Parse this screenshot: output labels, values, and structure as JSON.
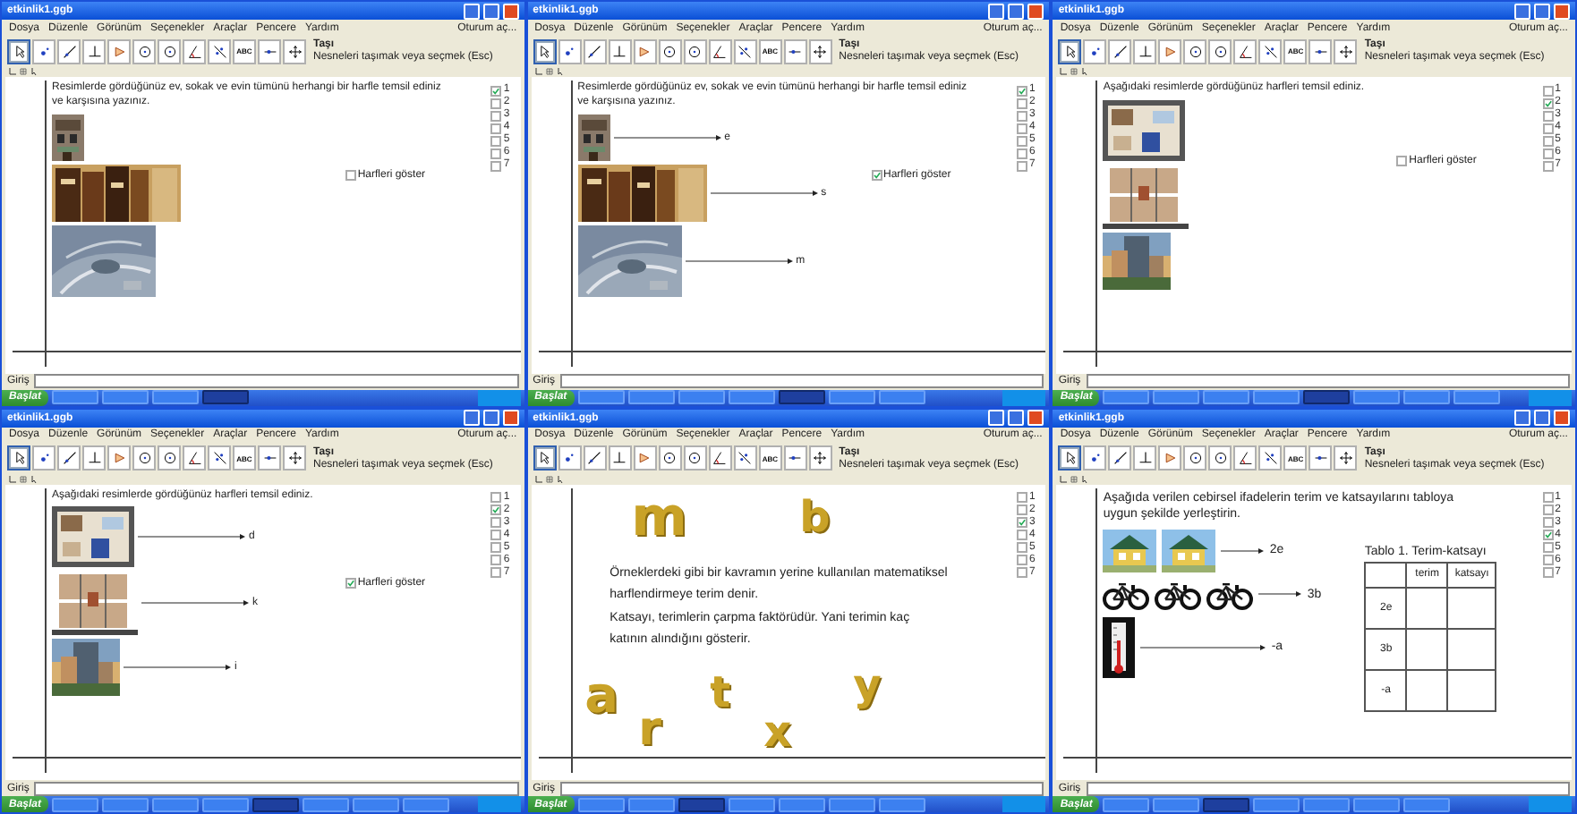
{
  "panels": [
    {
      "kind": "photos",
      "title": "etkinlik1.ggb",
      "menu": [
        "Dosya",
        "Düzenle",
        "Görünüm",
        "Seçenekler",
        "Araçlar",
        "Pencere",
        "Yardım"
      ],
      "login": "Oturum aç...",
      "tool_name": "Taşı",
      "tool_hint": "Nesneleri taşımak veya seçmek (Esc)",
      "tools": [
        {
          "kind": "pointer",
          "selected": true
        },
        {
          "kind": "point",
          "selected": false
        },
        {
          "kind": "line",
          "selected": false
        },
        {
          "kind": "perpendicular",
          "selected": false
        },
        {
          "kind": "polygon",
          "selected": false
        },
        {
          "kind": "circle",
          "selected": false
        },
        {
          "kind": "circle",
          "selected": false
        },
        {
          "kind": "angle",
          "selected": false
        },
        {
          "kind": "reflect",
          "selected": false
        },
        {
          "kind": "text",
          "label": "ABC",
          "selected": false
        },
        {
          "kind": "slider",
          "selected": false
        },
        {
          "kind": "move",
          "selected": false
        }
      ],
      "steps": [
        {
          "label": "1",
          "checked": true
        },
        {
          "label": "2",
          "checked": false
        },
        {
          "label": "3",
          "checked": false
        },
        {
          "label": "4",
          "checked": false
        },
        {
          "label": "5",
          "checked": false
        },
        {
          "label": "6",
          "checked": false
        },
        {
          "label": "7",
          "checked": false
        }
      ],
      "intro": "Resimlerde gördüğünüz ev, sokak ve evin tümünü herhangi bir harfle temsil ediniz ve karşısına yazınız.",
      "show": {
        "label": "Harfleri göster",
        "checked": false
      },
      "rows": [
        {
          "pictures": [
            {
              "kind": "facade"
            }
          ]
        },
        {
          "pictures": [
            {
              "kind": "street"
            }
          ]
        },
        {
          "pictures": [
            {
              "kind": "aerial"
            }
          ]
        }
      ],
      "input_label": "Giriş",
      "start": "Başlat",
      "tasks": [
        {
          "selected": false
        },
        {
          "selected": false
        },
        {
          "selected": false
        },
        {
          "selected": true
        }
      ]
    },
    {
      "kind": "photos",
      "title": "etkinlik1.ggb",
      "menu": [
        "Dosya",
        "Düzenle",
        "Görünüm",
        "Seçenekler",
        "Araçlar",
        "Pencere",
        "Yardım"
      ],
      "login": "Oturum aç...",
      "tool_name": "Taşı",
      "tool_hint": "Nesneleri taşımak veya seçmek (Esc)",
      "tools": [
        {
          "kind": "pointer",
          "selected": true
        },
        {
          "kind": "point",
          "selected": false
        },
        {
          "kind": "line",
          "selected": false
        },
        {
          "kind": "perpendicular",
          "selected": false
        },
        {
          "kind": "polygon",
          "selected": false
        },
        {
          "kind": "circle",
          "selected": false
        },
        {
          "kind": "circle",
          "selected": false
        },
        {
          "kind": "angle",
          "selected": false
        },
        {
          "kind": "reflect",
          "selected": false
        },
        {
          "kind": "text",
          "label": "ABC",
          "selected": false
        },
        {
          "kind": "slider",
          "selected": false
        },
        {
          "kind": "move",
          "selected": false
        }
      ],
      "steps": [
        {
          "label": "1",
          "checked": true
        },
        {
          "label": "2",
          "checked": false
        },
        {
          "label": "3",
          "checked": false
        },
        {
          "label": "4",
          "checked": false
        },
        {
          "label": "5",
          "checked": false
        },
        {
          "label": "6",
          "checked": false
        },
        {
          "label": "7",
          "checked": false
        }
      ],
      "intro": "Resimlerde gördüğünüz ev, sokak ve evin tümünü herhangi bir harfle temsil ediniz ve karşısına yazınız.",
      "show": {
        "label": "Harfleri göster",
        "checked": true
      },
      "rows": [
        {
          "pictures": [
            {
              "kind": "facade"
            }
          ],
          "label": "e"
        },
        {
          "pictures": [
            {
              "kind": "street"
            }
          ],
          "label": "s"
        },
        {
          "pictures": [
            {
              "kind": "aerial"
            }
          ],
          "label": "m"
        }
      ],
      "input_label": "Giriş",
      "start": "Başlat",
      "tasks": [
        {
          "selected": false
        },
        {
          "selected": false
        },
        {
          "selected": false
        },
        {
          "selected": false
        },
        {
          "selected": true
        },
        {
          "selected": false
        },
        {
          "selected": false
        }
      ]
    },
    {
      "kind": "photos",
      "title": "etkinlik1.ggb",
      "menu": [
        "Dosya",
        "Düzenle",
        "Görünüm",
        "Seçenekler",
        "Araçlar",
        "Pencere",
        "Yardım"
      ],
      "login": "Oturum aç...",
      "tool_name": "Taşı",
      "tool_hint": "Nesneleri taşımak veya seçmek (Esc)",
      "tools": [
        {
          "kind": "pointer",
          "selected": true
        },
        {
          "kind": "point",
          "selected": false
        },
        {
          "kind": "line",
          "selected": false
        },
        {
          "kind": "perpendicular",
          "selected": false
        },
        {
          "kind": "polygon",
          "selected": false
        },
        {
          "kind": "circle",
          "selected": false
        },
        {
          "kind": "circle",
          "selected": false
        },
        {
          "kind": "angle",
          "selected": false
        },
        {
          "kind": "reflect",
          "selected": false
        },
        {
          "kind": "text",
          "label": "ABC",
          "selected": false
        },
        {
          "kind": "slider",
          "selected": false
        },
        {
          "kind": "move",
          "selected": false
        }
      ],
      "steps": [
        {
          "label": "1",
          "checked": false
        },
        {
          "label": "2",
          "checked": true
        },
        {
          "label": "3",
          "checked": false
        },
        {
          "label": "4",
          "checked": false
        },
        {
          "label": "5",
          "checked": false
        },
        {
          "label": "6",
          "checked": false
        },
        {
          "label": "7",
          "checked": false
        }
      ],
      "intro": "Aşağıdaki resimlerde gördüğünüz harfleri temsil ediniz.",
      "show": {
        "label": "Harfleri göster",
        "checked": false
      },
      "rows": [
        {
          "pictures": [
            {
              "kind": "room"
            }
          ]
        },
        {
          "pictures": [
            {
              "kind": "plan"
            }
          ]
        },
        {
          "pictures": [
            {
              "kind": "tower"
            }
          ]
        }
      ],
      "input_label": "Giriş",
      "start": "Başlat",
      "tasks": [
        {
          "selected": false
        },
        {
          "selected": false
        },
        {
          "selected": false
        },
        {
          "selected": false
        },
        {
          "selected": true
        },
        {
          "selected": false
        },
        {
          "selected": false
        },
        {
          "selected": false
        }
      ]
    },
    {
      "kind": "photos",
      "title": "etkinlik1.ggb",
      "menu": [
        "Dosya",
        "Düzenle",
        "Görünüm",
        "Seçenekler",
        "Araçlar",
        "Pencere",
        "Yardım"
      ],
      "login": "Oturum aç...",
      "tool_name": "Taşı",
      "tool_hint": "Nesneleri taşımak veya seçmek (Esc)",
      "tools": [
        {
          "kind": "pointer",
          "selected": true
        },
        {
          "kind": "point",
          "selected": false
        },
        {
          "kind": "line",
          "selected": false
        },
        {
          "kind": "perpendicular",
          "selected": false
        },
        {
          "kind": "polygon",
          "selected": false
        },
        {
          "kind": "circle",
          "selected": false
        },
        {
          "kind": "circle",
          "selected": false
        },
        {
          "kind": "angle",
          "selected": false
        },
        {
          "kind": "reflect",
          "selected": false
        },
        {
          "kind": "text",
          "label": "ABC",
          "selected": false
        },
        {
          "kind": "slider",
          "selected": false
        },
        {
          "kind": "move",
          "selected": false
        }
      ],
      "steps": [
        {
          "label": "1",
          "checked": false
        },
        {
          "label": "2",
          "checked": true
        },
        {
          "label": "3",
          "checked": false
        },
        {
          "label": "4",
          "checked": false
        },
        {
          "label": "5",
          "checked": false
        },
        {
          "label": "6",
          "checked": false
        },
        {
          "label": "7",
          "checked": false
        }
      ],
      "intro": "Aşağıdaki resimlerde gördüğünüz harfleri temsil ediniz.",
      "show": {
        "label": "Harfleri göster",
        "checked": true
      },
      "rows": [
        {
          "pictures": [
            {
              "kind": "room"
            }
          ],
          "label": "d"
        },
        {
          "pictures": [
            {
              "kind": "plan"
            }
          ],
          "label": "k"
        },
        {
          "pictures": [
            {
              "kind": "tower"
            }
          ],
          "label": "i"
        }
      ],
      "input_label": "Giriş",
      "start": "Başlat",
      "tasks": [
        {
          "selected": false
        },
        {
          "selected": false
        },
        {
          "selected": false
        },
        {
          "selected": false
        },
        {
          "selected": true
        },
        {
          "selected": false
        },
        {
          "selected": false
        },
        {
          "selected": false
        }
      ]
    },
    {
      "kind": "letters",
      "title": "etkinlik1.ggb",
      "menu": [
        "Dosya",
        "Düzenle",
        "Görünüm",
        "Seçenekler",
        "Araçlar",
        "Pencere",
        "Yardım"
      ],
      "login": "Oturum aç...",
      "tool_name": "Taşı",
      "tool_hint": "Nesneleri taşımak veya seçmek (Esc)",
      "tools": [
        {
          "kind": "pointer",
          "selected": true
        },
        {
          "kind": "point",
          "selected": false
        },
        {
          "kind": "line",
          "selected": false
        },
        {
          "kind": "perpendicular",
          "selected": false
        },
        {
          "kind": "polygon",
          "selected": false
        },
        {
          "kind": "circle",
          "selected": false
        },
        {
          "kind": "circle",
          "selected": false
        },
        {
          "kind": "angle",
          "selected": false
        },
        {
          "kind": "reflect",
          "selected": false
        },
        {
          "kind": "text",
          "label": "ABC",
          "selected": false
        },
        {
          "kind": "slider",
          "selected": false
        },
        {
          "kind": "move",
          "selected": false
        }
      ],
      "steps": [
        {
          "label": "1",
          "checked": false
        },
        {
          "label": "2",
          "checked": false
        },
        {
          "label": "3",
          "checked": true
        },
        {
          "label": "4",
          "checked": false
        },
        {
          "label": "5",
          "checked": false
        },
        {
          "label": "6",
          "checked": false
        },
        {
          "label": "7",
          "checked": false
        }
      ],
      "letters": [
        "m",
        "b",
        "a",
        "t",
        "y",
        "r",
        "x"
      ],
      "paragraphs": [
        "Örneklerdeki gibi bir kavramın yerine kullanılan matematiksel harflendirmeye terim denir.",
        "Katsayı, terimlerin çarpma faktörüdür. Yani terimin kaç katının alındığını gösterir."
      ],
      "input_label": "Giriş",
      "start": "Başlat",
      "tasks": [
        {
          "selected": false
        },
        {
          "selected": false
        },
        {
          "selected": true
        },
        {
          "selected": false
        },
        {
          "selected": false
        },
        {
          "selected": false
        },
        {
          "selected": false
        }
      ]
    },
    {
      "kind": "table",
      "title": "etkinlik1.ggb",
      "menu": [
        "Dosya",
        "Düzenle",
        "Görünüm",
        "Seçenekler",
        "Araçlar",
        "Pencere",
        "Yardım"
      ],
      "login": "Oturum aç...",
      "tool_name": "Taşı",
      "tool_hint": "Nesneleri taşımak veya seçmek (Esc)",
      "tools": [
        {
          "kind": "pointer",
          "selected": true
        },
        {
          "kind": "point",
          "selected": false
        },
        {
          "kind": "line",
          "selected": false
        },
        {
          "kind": "perpendicular",
          "selected": false
        },
        {
          "kind": "polygon",
          "selected": false
        },
        {
          "kind": "circle",
          "selected": false
        },
        {
          "kind": "circle",
          "selected": false
        },
        {
          "kind": "angle",
          "selected": false
        },
        {
          "kind": "reflect",
          "selected": false
        },
        {
          "kind": "text",
          "label": "ABC",
          "selected": false
        },
        {
          "kind": "slider",
          "selected": false
        },
        {
          "kind": "move",
          "selected": false
        }
      ],
      "steps": [
        {
          "label": "1",
          "checked": false
        },
        {
          "label": "2",
          "checked": false
        },
        {
          "label": "3",
          "checked": false
        },
        {
          "label": "4",
          "checked": true
        },
        {
          "label": "5",
          "checked": false
        },
        {
          "label": "6",
          "checked": false
        },
        {
          "label": "7",
          "checked": false
        }
      ],
      "intro": "Aşağıda verilen cebirsel ifadelerin terim ve katsayılarını tabloya uygun şekilde yerleştirin.",
      "rows": [
        {
          "pictures": [
            {
              "kind": "house"
            },
            {
              "kind": "house"
            }
          ],
          "label": "2e"
        },
        {
          "pictures": [
            {
              "kind": "bike"
            },
            {
              "kind": "bike"
            },
            {
              "kind": "bike"
            }
          ],
          "label": "3b"
        },
        {
          "pictures": [
            {
              "kind": "thermometer"
            }
          ],
          "label": "-a"
        }
      ],
      "table": {
        "caption": "Tablo 1. Terim-katsayı",
        "columns": [
          "terim",
          "katsayı"
        ],
        "rows": [
          "2e",
          "3b",
          "-a"
        ]
      },
      "input_label": "Giriş",
      "start": "Başlat",
      "tasks": [
        {
          "selected": false
        },
        {
          "selected": false
        },
        {
          "selected": true
        },
        {
          "selected": false
        },
        {
          "selected": false
        },
        {
          "selected": false
        },
        {
          "selected": false
        }
      ]
    }
  ]
}
